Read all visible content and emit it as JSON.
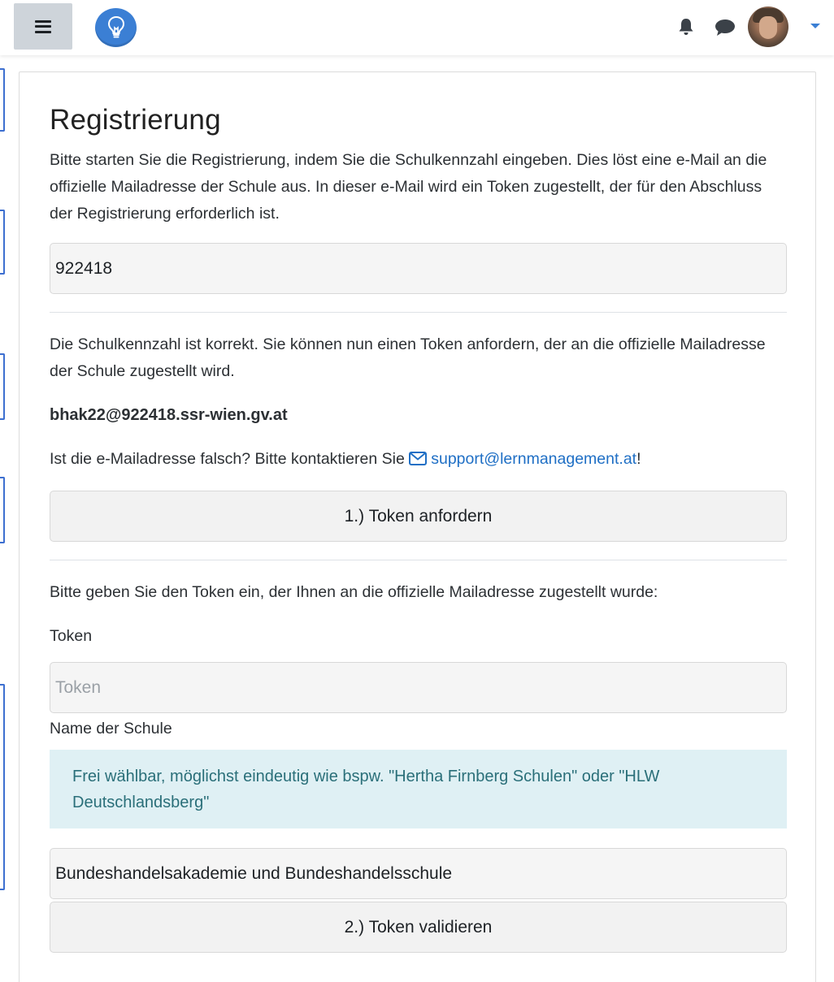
{
  "navbar": {
    "menu_icon": "hamburger-menu-icon",
    "logo_icon": "lightbulb-icon",
    "notification_icon": "bell-icon",
    "messages_icon": "chat-bubble-icon",
    "user_menu_icon": "caret-down-icon",
    "accent_color": "#3b7fd4"
  },
  "registration": {
    "title": "Registrierung",
    "intro": "Bitte starten Sie die Registrierung, indem Sie die Schulkennzahl eingeben. Dies löst eine e-Mail an die offizielle Mailadresse der Schule aus. In dieser e-Mail wird ein Token zugestellt, der für den Abschluss der Registrierung erforderlich ist.",
    "school_code_value": "922418",
    "code_correct_text": "Die Schulkennzahl ist korrekt. Sie können nun einen Token anfordern, der an die offizielle Mailadresse der Schule zugestellt wird.",
    "school_email": "bhak22@922418.ssr-wien.gv.at",
    "wrong_email_prefix": "Ist die e-Mailadresse falsch? Bitte kontaktieren Sie",
    "support_email": "support@lernmanagement.at",
    "wrong_email_suffix": "!",
    "request_token_button": "1.) Token anfordern",
    "enter_token_text": "Bitte geben Sie den Token ein, der Ihnen an die offizielle Mailadresse zugestellt wurde:",
    "token_label": "Token",
    "token_placeholder": "Token",
    "school_name_label": "Name der Schule",
    "school_name_hint": "Frei wählbar, möglichst eindeutig wie bspw. \"Hertha Firnberg Schulen\" oder \"HLW Deutschlandsberg\"",
    "school_name_value": "Bundeshandelsakademie und Bundeshandelsschule",
    "validate_token_button": "2.) Token validieren",
    "link_color": "#1f6fc5",
    "info_background": "#dff0f4"
  }
}
